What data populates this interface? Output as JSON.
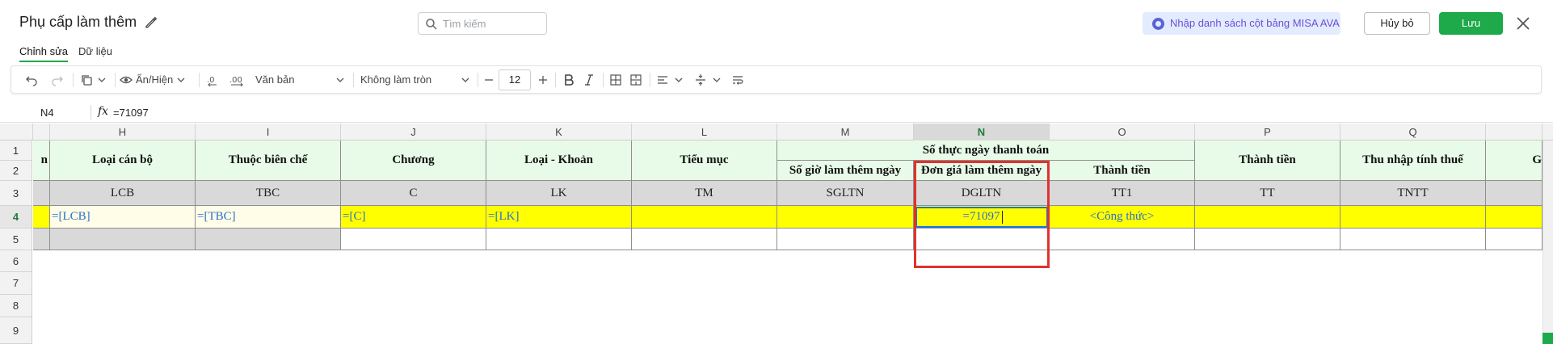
{
  "header": {
    "title": "Phụ cấp làm thêm",
    "search_placeholder": "Tìm kiếm",
    "ava_label": "Nhập danh sách cột bảng MISA AVA",
    "cancel_label": "Hủy bỏ",
    "save_label": "Lưu"
  },
  "tabs": [
    {
      "label": "Chỉnh sửa",
      "active": true
    },
    {
      "label": "Dữ liệu",
      "active": false
    }
  ],
  "toolbar": {
    "visibility_label": "Ẩn/Hiện",
    "format_label": "Văn bản",
    "rounding_label": "Không làm tròn",
    "font_size": "12"
  },
  "formula_bar": {
    "cell_ref": "N4",
    "fx": "fx",
    "value": "=71097"
  },
  "grid": {
    "columns": [
      "H",
      "I",
      "J",
      "K",
      "L",
      "M",
      "N",
      "O",
      "P",
      "Q"
    ],
    "selected_column": "N",
    "rows": [
      "1",
      "2",
      "3",
      "4",
      "5",
      "6",
      "7",
      "8",
      "9"
    ],
    "selected_row": "4",
    "partial_left_header": "n",
    "partial_right_header": "G",
    "headers": {
      "H": "Loại cán bộ",
      "I": "Thuộc biên chế",
      "J": "Chương",
      "K": "Loại - Khoản",
      "L": "Tiểu mục",
      "MNO_group": "Số thực ngày thanh toán",
      "M": "Số giờ làm thêm ngày",
      "N": "Đơn giá làm thêm ngày",
      "O": "Thành tiền",
      "P": "Thành tiền",
      "Q": "Thu nhập tính thuế"
    },
    "codes": {
      "H": "LCB",
      "I": "TBC",
      "J": "C",
      "K": "LK",
      "L": "TM",
      "M": "SGLTN",
      "N": "DGLTN",
      "O": "TT1",
      "P": "TT",
      "Q": "TNTT"
    },
    "row4": {
      "H": "=[LCB]",
      "I": "=[TBC]",
      "J": "=[C]",
      "K": "=[LK]",
      "N": "=71097",
      "O": "<Công thức>"
    }
  },
  "colors": {
    "accent_green": "#1ea94b",
    "header_fill": "#e8fbe8",
    "formula_row_fill": "#ffff00",
    "highlight_border": "#e0322d"
  }
}
